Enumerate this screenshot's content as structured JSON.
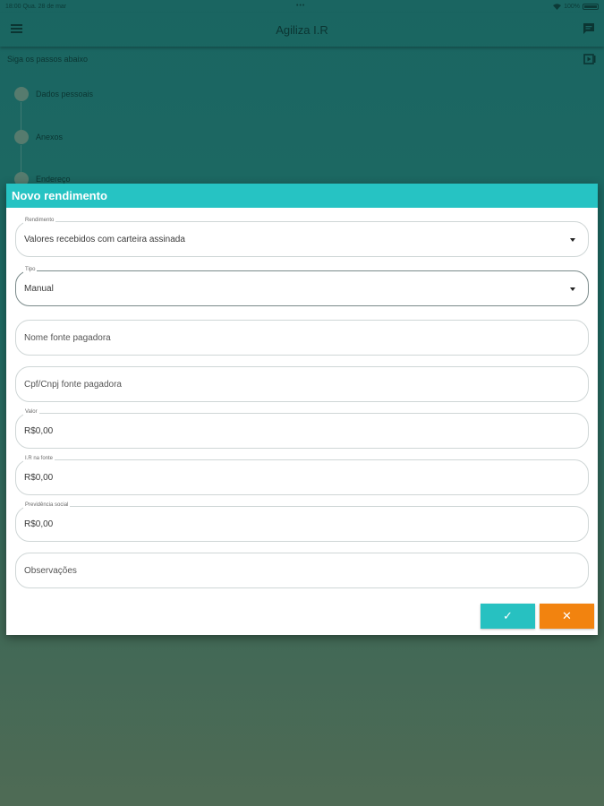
{
  "status_bar": {
    "time": "18:00",
    "date": "Qua. 28 de mar",
    "dots": "•••",
    "battery": "100%"
  },
  "app_bar": {
    "title": "Agiliza I.R"
  },
  "stepper": {
    "hint": "Siga os passos abaixo",
    "steps": [
      {
        "label": "Dados pessoais"
      },
      {
        "label": "Anexos"
      },
      {
        "label": "Endereço"
      }
    ]
  },
  "dialog": {
    "title": "Novo rendimento",
    "fields": [
      {
        "label": "Rendimento",
        "value": "Valores recebidos com carteira assinada",
        "placeholder": ""
      },
      {
        "label": "Tipo",
        "value": "Manual",
        "placeholder": ""
      },
      {
        "label": "",
        "value": "",
        "placeholder": "Nome fonte pagadora"
      },
      {
        "label": "",
        "value": "",
        "placeholder": "Cpf/Cnpj fonte pagadora"
      },
      {
        "label": "Valor",
        "value": "R$0,00",
        "placeholder": ""
      },
      {
        "label": "I.R na fonte",
        "value": "R$0,00",
        "placeholder": ""
      },
      {
        "label": "Previdência social",
        "value": "R$0,00",
        "placeholder": ""
      },
      {
        "label": "",
        "value": "",
        "placeholder": "Observações"
      }
    ],
    "confirm_label": "✓",
    "cancel_label": "✕"
  },
  "colors": {
    "accent": "#26c3c3",
    "cancel": "#f2830f",
    "background_top": "#1a6561",
    "background_bottom": "#4f6b55"
  },
  "icons": [
    "menu-icon",
    "chat-icon",
    "video-icon",
    "dropdown-caret-icon",
    "check-icon",
    "close-icon",
    "wifi-icon",
    "battery-icon"
  ]
}
